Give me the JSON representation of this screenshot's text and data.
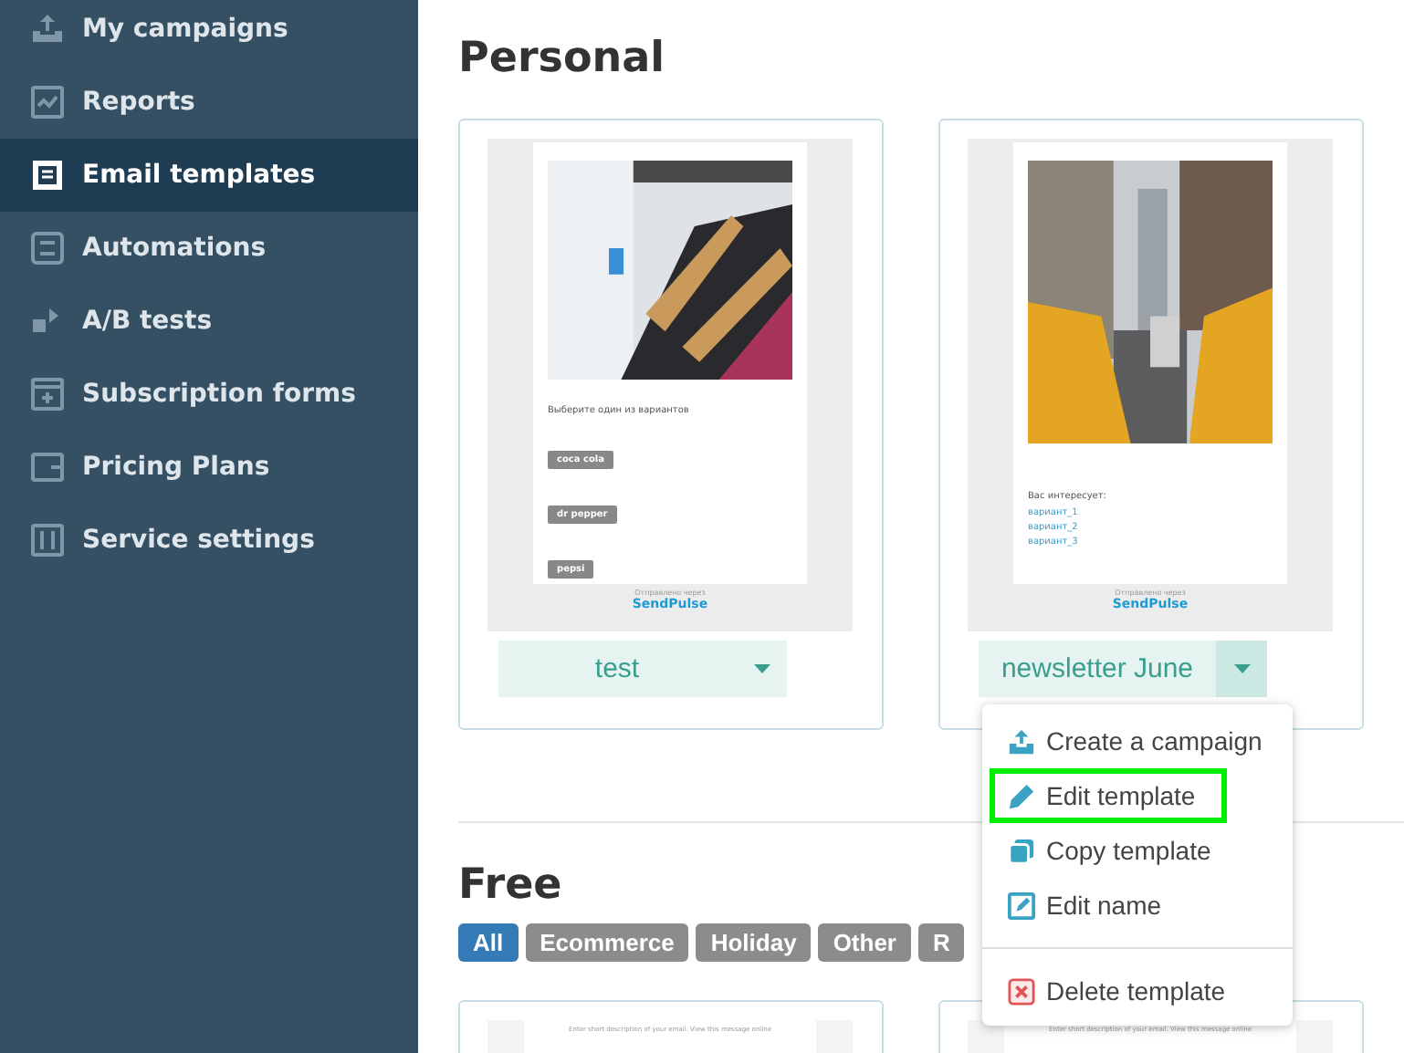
{
  "sidebar": {
    "items": [
      {
        "label": "My campaigns",
        "selected": false
      },
      {
        "label": "Reports",
        "selected": false
      },
      {
        "label": "Email templates",
        "selected": true
      },
      {
        "label": "Automations",
        "selected": false
      },
      {
        "label": "A/B tests",
        "selected": false
      },
      {
        "label": "Subscription forms",
        "selected": false
      },
      {
        "label": "Pricing Plans",
        "selected": false
      },
      {
        "label": "Service settings",
        "selected": false
      }
    ]
  },
  "personal": {
    "title": "Personal",
    "templates": [
      {
        "name": "test",
        "menu_open": false,
        "preview": {
          "kind": "clothes",
          "heading": "Выберите один из вариантов",
          "buttons": [
            "coca cola",
            "dr pepper",
            "pepsi"
          ],
          "footer": "Отправлено через",
          "brand": "SendPulse"
        }
      },
      {
        "name": "newsletter June",
        "menu_open": true,
        "preview": {
          "kind": "street",
          "heading": "Вас интересует:",
          "links": [
            "вариант_1",
            "вариант_2",
            "вариант_3"
          ],
          "footer": "Отправлено через",
          "brand": "SendPulse"
        }
      }
    ]
  },
  "menu": {
    "items": [
      {
        "label": "Create a campaign",
        "highlighted": false
      },
      {
        "label": "Edit template",
        "highlighted": true
      },
      {
        "label": "Copy template",
        "highlighted": false
      },
      {
        "label": "Edit name",
        "highlighted": false
      },
      {
        "label": "Delete template",
        "highlighted": false
      }
    ]
  },
  "free": {
    "title": "Free",
    "tags": [
      {
        "label": "All",
        "selected": true
      },
      {
        "label": "Ecommerce",
        "selected": false
      },
      {
        "label": "Holiday",
        "selected": false
      },
      {
        "label": "Other",
        "selected": false
      },
      {
        "label": "R",
        "selected": false
      }
    ],
    "previews": [
      {
        "text": "Enter short description of your email. View this message online"
      },
      {
        "text": "Enter short description of your email. View this message online"
      }
    ]
  }
}
